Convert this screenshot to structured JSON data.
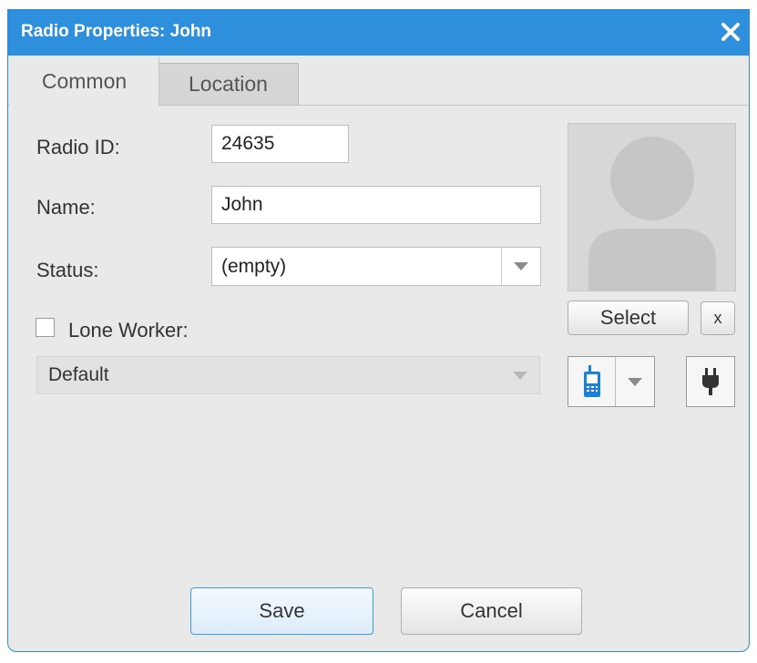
{
  "window": {
    "title": "Radio Properties: John"
  },
  "tabs": [
    {
      "label": "Common",
      "active": true
    },
    {
      "label": "Location",
      "active": false
    }
  ],
  "form": {
    "radio_id_label": "Radio ID:",
    "radio_id_value": "24635",
    "name_label": "Name:",
    "name_value": "John",
    "status_label": "Status:",
    "status_value": "(empty)",
    "lone_worker_label": "Lone Worker:",
    "lone_worker_checked": false,
    "lone_worker_value": "Default"
  },
  "photo": {
    "select_label": "Select",
    "clear_label": "x"
  },
  "footer": {
    "save_label": "Save",
    "cancel_label": "Cancel"
  },
  "icons": {
    "close": "close-icon",
    "device": "radio-device-icon",
    "plug": "power-plug-icon",
    "avatar": "avatar-placeholder"
  },
  "colors": {
    "titlebar": "#2e8fdc",
    "accent": "#2b8bd8",
    "background": "#e9e9e9"
  }
}
